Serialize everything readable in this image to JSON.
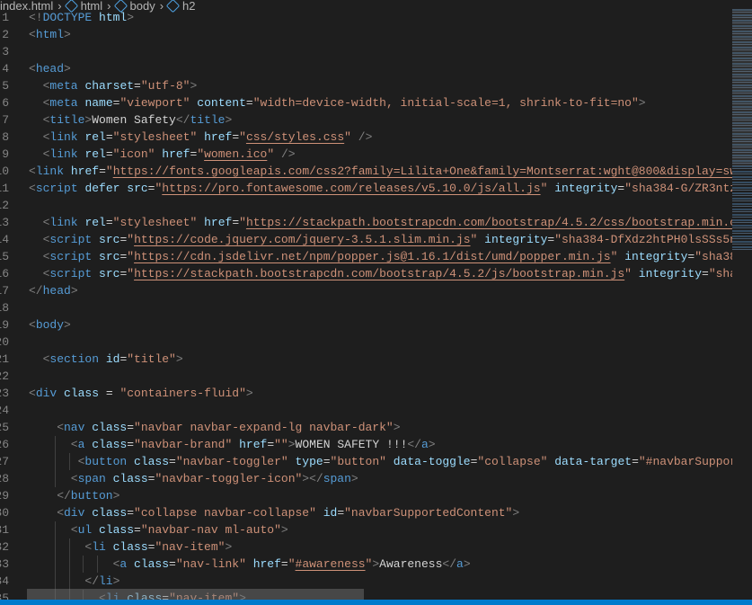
{
  "breadcrumb": {
    "items": [
      "index.html",
      "html",
      "body",
      "h2"
    ]
  },
  "colors": {
    "background": "#1e1e1e",
    "tag": "#569cd6",
    "attribute": "#9cdcfe",
    "string": "#ce9178",
    "text": "#d4d4d4",
    "bracket": "#808080",
    "line_number": "#858585",
    "statusbar": "#007acc"
  },
  "editor": {
    "language": "html",
    "lines": [
      {
        "n": 1,
        "i": 0,
        "t": [
          [
            "b",
            "<!"
          ],
          [
            "g",
            "DOCTYPE"
          ],
          [
            "x",
            " "
          ],
          [
            "a",
            "html"
          ],
          [
            "b",
            ">"
          ]
        ]
      },
      {
        "n": 2,
        "i": 0,
        "t": [
          [
            "b",
            "<"
          ],
          [
            "g",
            "html"
          ],
          [
            "b",
            ">"
          ]
        ]
      },
      {
        "n": 3,
        "i": 0,
        "t": []
      },
      {
        "n": 4,
        "i": 0,
        "t": [
          [
            "b",
            "<"
          ],
          [
            "g",
            "head"
          ],
          [
            "b",
            ">"
          ]
        ]
      },
      {
        "n": 5,
        "i": 2,
        "t": [
          [
            "b",
            "<"
          ],
          [
            "g",
            "meta"
          ],
          [
            "x",
            " "
          ],
          [
            "a",
            "charset"
          ],
          [
            "e",
            "="
          ],
          [
            "s",
            "\"utf-8\""
          ],
          [
            "b",
            ">"
          ]
        ]
      },
      {
        "n": 6,
        "i": 2,
        "t": [
          [
            "b",
            "<"
          ],
          [
            "g",
            "meta"
          ],
          [
            "x",
            " "
          ],
          [
            "a",
            "name"
          ],
          [
            "e",
            "="
          ],
          [
            "s",
            "\"viewport\""
          ],
          [
            "x",
            " "
          ],
          [
            "a",
            "content"
          ],
          [
            "e",
            "="
          ],
          [
            "s",
            "\"width=device-width, initial-scale=1, shrink-to-fit=no\""
          ],
          [
            "b",
            ">"
          ]
        ]
      },
      {
        "n": 7,
        "i": 2,
        "t": [
          [
            "b",
            "<"
          ],
          [
            "g",
            "title"
          ],
          [
            "b",
            ">"
          ],
          [
            "x",
            "Women Safety"
          ],
          [
            "b",
            "</"
          ],
          [
            "g",
            "title"
          ],
          [
            "b",
            ">"
          ]
        ]
      },
      {
        "n": 8,
        "i": 2,
        "t": [
          [
            "b",
            "<"
          ],
          [
            "g",
            "link"
          ],
          [
            "x",
            " "
          ],
          [
            "a",
            "rel"
          ],
          [
            "e",
            "="
          ],
          [
            "s",
            "\"stylesheet\""
          ],
          [
            "x",
            " "
          ],
          [
            "a",
            "href"
          ],
          [
            "e",
            "="
          ],
          [
            "s",
            "\""
          ],
          [
            "u",
            "css/styles.css"
          ],
          [
            "s",
            "\""
          ],
          [
            "x",
            " "
          ],
          [
            "b",
            "/>"
          ]
        ]
      },
      {
        "n": 9,
        "i": 2,
        "t": [
          [
            "b",
            "<"
          ],
          [
            "g",
            "link"
          ],
          [
            "x",
            " "
          ],
          [
            "a",
            "rel"
          ],
          [
            "e",
            "="
          ],
          [
            "s",
            "\"icon\""
          ],
          [
            "x",
            " "
          ],
          [
            "a",
            "href"
          ],
          [
            "e",
            "="
          ],
          [
            "s",
            "\""
          ],
          [
            "u",
            "women.ico"
          ],
          [
            "s",
            "\""
          ],
          [
            "x",
            " "
          ],
          [
            "b",
            "/>"
          ]
        ]
      },
      {
        "n": 10,
        "i": 0,
        "t": [
          [
            "b",
            "<"
          ],
          [
            "g",
            "link"
          ],
          [
            "x",
            " "
          ],
          [
            "a",
            "href"
          ],
          [
            "e",
            "="
          ],
          [
            "s",
            "\""
          ],
          [
            "u",
            "https://fonts.googleapis.com/css2?family=Lilita+One&family=Montserrat:wght@800&display=swa"
          ]
        ]
      },
      {
        "n": 11,
        "i": 0,
        "t": [
          [
            "b",
            "<"
          ],
          [
            "g",
            "script"
          ],
          [
            "x",
            " "
          ],
          [
            "a",
            "defer"
          ],
          [
            "x",
            " "
          ],
          [
            "a",
            "src"
          ],
          [
            "e",
            "="
          ],
          [
            "s",
            "\""
          ],
          [
            "u",
            "https://pro.fontawesome.com/releases/v5.10.0/js/all.js"
          ],
          [
            "s",
            "\""
          ],
          [
            "x",
            " "
          ],
          [
            "a",
            "integrity"
          ],
          [
            "e",
            "="
          ],
          [
            "s",
            "\"sha384-G/ZR3ntz6"
          ]
        ]
      },
      {
        "n": 12,
        "i": 0,
        "t": []
      },
      {
        "n": 13,
        "i": 2,
        "t": [
          [
            "b",
            "<"
          ],
          [
            "g",
            "link"
          ],
          [
            "x",
            " "
          ],
          [
            "a",
            "rel"
          ],
          [
            "e",
            "="
          ],
          [
            "s",
            "\"stylesheet\""
          ],
          [
            "x",
            " "
          ],
          [
            "a",
            "href"
          ],
          [
            "e",
            "="
          ],
          [
            "s",
            "\""
          ],
          [
            "u",
            "https://stackpath.bootstrapcdn.com/bootstrap/4.5.2/css/bootstrap.min.cs"
          ]
        ]
      },
      {
        "n": 14,
        "i": 2,
        "t": [
          [
            "b",
            "<"
          ],
          [
            "g",
            "script"
          ],
          [
            "x",
            " "
          ],
          [
            "a",
            "src"
          ],
          [
            "e",
            "="
          ],
          [
            "s",
            "\""
          ],
          [
            "u",
            "https://code.jquery.com/jquery-3.5.1.slim.min.js"
          ],
          [
            "s",
            "\""
          ],
          [
            "x",
            " "
          ],
          [
            "a",
            "integrity"
          ],
          [
            "e",
            "="
          ],
          [
            "s",
            "\"sha384-DfXdz2htPH0lsSSs5nC"
          ]
        ]
      },
      {
        "n": 15,
        "i": 2,
        "t": [
          [
            "b",
            "<"
          ],
          [
            "g",
            "script"
          ],
          [
            "x",
            " "
          ],
          [
            "a",
            "src"
          ],
          [
            "e",
            "="
          ],
          [
            "s",
            "\""
          ],
          [
            "u",
            "https://cdn.jsdelivr.net/npm/popper.js@1.16.1/dist/umd/popper.min.js"
          ],
          [
            "s",
            "\""
          ],
          [
            "x",
            " "
          ],
          [
            "a",
            "integrity"
          ],
          [
            "e",
            "="
          ],
          [
            "s",
            "\"sha384"
          ]
        ]
      },
      {
        "n": 16,
        "i": 2,
        "t": [
          [
            "b",
            "<"
          ],
          [
            "g",
            "script"
          ],
          [
            "x",
            " "
          ],
          [
            "a",
            "src"
          ],
          [
            "e",
            "="
          ],
          [
            "s",
            "\""
          ],
          [
            "u",
            "https://stackpath.bootstrapcdn.com/bootstrap/4.5.2/js/bootstrap.min.js"
          ],
          [
            "s",
            "\""
          ],
          [
            "x",
            " "
          ],
          [
            "a",
            "integrity"
          ],
          [
            "e",
            "="
          ],
          [
            "s",
            "\"sha3"
          ]
        ]
      },
      {
        "n": 17,
        "i": 0,
        "t": [
          [
            "b",
            "</"
          ],
          [
            "g",
            "head"
          ],
          [
            "b",
            ">"
          ]
        ]
      },
      {
        "n": 18,
        "i": 0,
        "t": []
      },
      {
        "n": 19,
        "i": 0,
        "t": [
          [
            "b",
            "<"
          ],
          [
            "g",
            "body"
          ],
          [
            "b",
            ">"
          ]
        ]
      },
      {
        "n": 20,
        "i": 0,
        "t": []
      },
      {
        "n": 21,
        "i": 2,
        "t": [
          [
            "b",
            "<"
          ],
          [
            "g",
            "section"
          ],
          [
            "x",
            " "
          ],
          [
            "a",
            "id"
          ],
          [
            "e",
            "="
          ],
          [
            "s",
            "\"title\""
          ],
          [
            "b",
            ">"
          ]
        ]
      },
      {
        "n": 22,
        "i": 0,
        "t": []
      },
      {
        "n": 23,
        "i": 0,
        "t": [
          [
            "b",
            "<"
          ],
          [
            "g",
            "div"
          ],
          [
            "x",
            " "
          ],
          [
            "a",
            "class"
          ],
          [
            "e",
            " = "
          ],
          [
            "s",
            "\"containers-fluid\""
          ],
          [
            "b",
            ">"
          ]
        ]
      },
      {
        "n": 24,
        "i": 0,
        "t": []
      },
      {
        "n": 25,
        "i": 4,
        "t": [
          [
            "b",
            "<"
          ],
          [
            "g",
            "nav"
          ],
          [
            "x",
            " "
          ],
          [
            "a",
            "class"
          ],
          [
            "e",
            "="
          ],
          [
            "s",
            "\"navbar navbar-expand-lg navbar-dark\""
          ],
          [
            "b",
            ">"
          ]
        ]
      },
      {
        "n": 26,
        "i": 6,
        "t": [
          [
            "b",
            "<"
          ],
          [
            "g",
            "a"
          ],
          [
            "x",
            " "
          ],
          [
            "a",
            "class"
          ],
          [
            "e",
            "="
          ],
          [
            "s",
            "\"navbar-brand\""
          ],
          [
            "x",
            " "
          ],
          [
            "a",
            "href"
          ],
          [
            "e",
            "="
          ],
          [
            "s",
            "\"\""
          ],
          [
            "b",
            ">"
          ],
          [
            "x",
            "WOMEN SAFETY !!!"
          ],
          [
            "b",
            "</"
          ],
          [
            "g",
            "a"
          ],
          [
            "b",
            ">"
          ]
        ]
      },
      {
        "n": 27,
        "i": 7,
        "t": [
          [
            "b",
            "<"
          ],
          [
            "g",
            "button"
          ],
          [
            "x",
            " "
          ],
          [
            "a",
            "class"
          ],
          [
            "e",
            "="
          ],
          [
            "s",
            "\"navbar-toggler\""
          ],
          [
            "x",
            " "
          ],
          [
            "a",
            "type"
          ],
          [
            "e",
            "="
          ],
          [
            "s",
            "\"button\""
          ],
          [
            "x",
            " "
          ],
          [
            "a",
            "data-toggle"
          ],
          [
            "e",
            "="
          ],
          [
            "s",
            "\"collapse\""
          ],
          [
            "x",
            " "
          ],
          [
            "a",
            "data-target"
          ],
          [
            "e",
            "="
          ],
          [
            "s",
            "\"#navbarSupport"
          ]
        ]
      },
      {
        "n": 28,
        "i": 6,
        "t": [
          [
            "b",
            "<"
          ],
          [
            "g",
            "span"
          ],
          [
            "x",
            " "
          ],
          [
            "a",
            "class"
          ],
          [
            "e",
            "="
          ],
          [
            "s",
            "\"navbar-toggler-icon\""
          ],
          [
            "b",
            "></"
          ],
          [
            "g",
            "span"
          ],
          [
            "b",
            ">"
          ]
        ]
      },
      {
        "n": 29,
        "i": 4,
        "t": [
          [
            "b",
            "</"
          ],
          [
            "g",
            "button"
          ],
          [
            "b",
            ">"
          ]
        ]
      },
      {
        "n": 30,
        "i": 4,
        "t": [
          [
            "b",
            "<"
          ],
          [
            "g",
            "div"
          ],
          [
            "x",
            " "
          ],
          [
            "a",
            "class"
          ],
          [
            "e",
            "="
          ],
          [
            "s",
            "\"collapse navbar-collapse\""
          ],
          [
            "x",
            " "
          ],
          [
            "a",
            "id"
          ],
          [
            "e",
            "="
          ],
          [
            "s",
            "\"navbarSupportedContent\""
          ],
          [
            "b",
            ">"
          ]
        ]
      },
      {
        "n": 31,
        "i": 6,
        "t": [
          [
            "b",
            "<"
          ],
          [
            "g",
            "ul"
          ],
          [
            "x",
            " "
          ],
          [
            "a",
            "class"
          ],
          [
            "e",
            "="
          ],
          [
            "s",
            "\"navbar-nav ml-auto\""
          ],
          [
            "b",
            ">"
          ]
        ]
      },
      {
        "n": 32,
        "i": 8,
        "t": [
          [
            "b",
            "<"
          ],
          [
            "g",
            "li"
          ],
          [
            "x",
            " "
          ],
          [
            "a",
            "class"
          ],
          [
            "e",
            "="
          ],
          [
            "s",
            "\"nav-item\""
          ],
          [
            "b",
            ">"
          ]
        ]
      },
      {
        "n": 33,
        "i": 12,
        "t": [
          [
            "b",
            "<"
          ],
          [
            "g",
            "a"
          ],
          [
            "x",
            " "
          ],
          [
            "a",
            "class"
          ],
          [
            "e",
            "="
          ],
          [
            "s",
            "\"nav-link\""
          ],
          [
            "x",
            " "
          ],
          [
            "a",
            "href"
          ],
          [
            "e",
            "="
          ],
          [
            "s",
            "\""
          ],
          [
            "u",
            "#awareness"
          ],
          [
            "s",
            "\""
          ],
          [
            "b",
            ">"
          ],
          [
            "x",
            "Awareness"
          ],
          [
            "b",
            "</"
          ],
          [
            "g",
            "a"
          ],
          [
            "b",
            ">"
          ]
        ]
      },
      {
        "n": 34,
        "i": 8,
        "t": [
          [
            "b",
            "</"
          ],
          [
            "g",
            "li"
          ],
          [
            "b",
            ">"
          ]
        ]
      },
      {
        "n": 35,
        "i": 10,
        "t": [
          [
            "b",
            "<"
          ],
          [
            "g",
            "li"
          ],
          [
            "x",
            " "
          ],
          [
            "a",
            "class"
          ],
          [
            "e",
            "="
          ],
          [
            "s",
            "\"nav-item\""
          ],
          [
            "b",
            ">"
          ]
        ]
      }
    ]
  }
}
